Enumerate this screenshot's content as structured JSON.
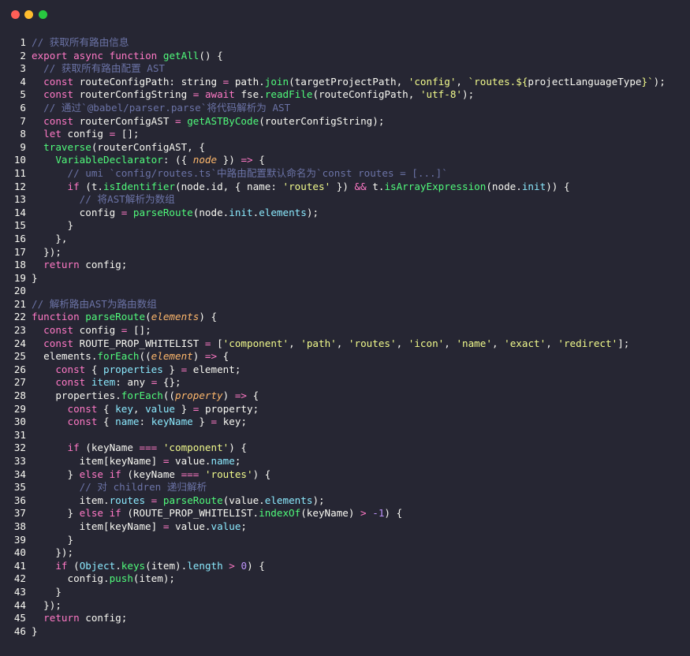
{
  "window": {
    "controls": [
      "close",
      "minimize",
      "zoom"
    ]
  },
  "colors": {
    "background": "#262633",
    "plain": "#f8f8f2",
    "keyword": "#ff79c6",
    "function": "#50fa7b",
    "string": "#f1fa8c",
    "comment": "#6b73a6",
    "param": "#ffb86c",
    "property": "#8be9fd",
    "number": "#bd93f9"
  },
  "lines": [
    [
      [
        "com",
        "// 获取所有路由信息"
      ]
    ],
    [
      [
        "kw",
        "export"
      ],
      [
        "plain",
        " "
      ],
      [
        "kw",
        "async"
      ],
      [
        "plain",
        " "
      ],
      [
        "kw",
        "function"
      ],
      [
        "plain",
        " "
      ],
      [
        "fn",
        "getAll"
      ],
      [
        "plain",
        "() {"
      ]
    ],
    [
      [
        "plain",
        "  "
      ],
      [
        "com",
        "// 获取所有路由配置 AST"
      ]
    ],
    [
      [
        "plain",
        "  "
      ],
      [
        "kw",
        "const"
      ],
      [
        "plain",
        " routeConfigPath: string "
      ],
      [
        "op",
        "="
      ],
      [
        "plain",
        " path."
      ],
      [
        "fn",
        "join"
      ],
      [
        "plain",
        "(targetProjectPath, "
      ],
      [
        "str",
        "'config'"
      ],
      [
        "plain",
        ", "
      ],
      [
        "str",
        "`routes.${"
      ],
      [
        "plain",
        "projectLanguageType"
      ],
      [
        "str",
        "}`"
      ],
      [
        "plain",
        ");"
      ]
    ],
    [
      [
        "plain",
        "  "
      ],
      [
        "kw",
        "const"
      ],
      [
        "plain",
        " routerConfigString "
      ],
      [
        "op",
        "="
      ],
      [
        "plain",
        " "
      ],
      [
        "kw",
        "await"
      ],
      [
        "plain",
        " fse."
      ],
      [
        "fn",
        "readFile"
      ],
      [
        "plain",
        "(routeConfigPath, "
      ],
      [
        "str",
        "'utf-8'"
      ],
      [
        "plain",
        ");"
      ]
    ],
    [
      [
        "plain",
        "  "
      ],
      [
        "com",
        "// 通过`@babel/parser.parse`将代码解析为 AST"
      ]
    ],
    [
      [
        "plain",
        "  "
      ],
      [
        "kw",
        "const"
      ],
      [
        "plain",
        " routerConfigAST "
      ],
      [
        "op",
        "="
      ],
      [
        "plain",
        " "
      ],
      [
        "fn",
        "getASTByCode"
      ],
      [
        "plain",
        "(routerConfigString);"
      ]
    ],
    [
      [
        "plain",
        "  "
      ],
      [
        "kw",
        "let"
      ],
      [
        "plain",
        " config "
      ],
      [
        "op",
        "="
      ],
      [
        "plain",
        " [];"
      ]
    ],
    [
      [
        "plain",
        "  "
      ],
      [
        "fn",
        "traverse"
      ],
      [
        "plain",
        "(routerConfigAST, {"
      ]
    ],
    [
      [
        "plain",
        "    "
      ],
      [
        "fn",
        "VariableDeclarator"
      ],
      [
        "plain",
        ": ({ "
      ],
      [
        "param",
        "node"
      ],
      [
        "plain",
        " }) "
      ],
      [
        "kw",
        "=>"
      ],
      [
        "plain",
        " {"
      ]
    ],
    [
      [
        "plain",
        "      "
      ],
      [
        "com",
        "// umi `config/routes.ts`中路由配置默认命名为`const routes = [...]`"
      ]
    ],
    [
      [
        "plain",
        "      "
      ],
      [
        "kw",
        "if"
      ],
      [
        "plain",
        " (t."
      ],
      [
        "fn",
        "isIdentifier"
      ],
      [
        "plain",
        "(node.id, { name: "
      ],
      [
        "str",
        "'routes'"
      ],
      [
        "plain",
        " }) "
      ],
      [
        "op",
        "&&"
      ],
      [
        "plain",
        " t."
      ],
      [
        "fn",
        "isArrayExpression"
      ],
      [
        "plain",
        "(node."
      ],
      [
        "prop",
        "init"
      ],
      [
        "plain",
        "))"
      ],
      [
        "plain",
        " {"
      ]
    ],
    [
      [
        "plain",
        "        "
      ],
      [
        "com",
        "// 将AST解析为数组"
      ]
    ],
    [
      [
        "plain",
        "        config "
      ],
      [
        "op",
        "="
      ],
      [
        "plain",
        " "
      ],
      [
        "fn",
        "parseRoute"
      ],
      [
        "plain",
        "(node."
      ],
      [
        "prop",
        "init"
      ],
      [
        "plain",
        "."
      ],
      [
        "prop",
        "elements"
      ],
      [
        "plain",
        ");"
      ]
    ],
    [
      [
        "plain",
        "      }"
      ]
    ],
    [
      [
        "plain",
        "    },"
      ]
    ],
    [
      [
        "plain",
        "  });"
      ]
    ],
    [
      [
        "plain",
        "  "
      ],
      [
        "kw",
        "return"
      ],
      [
        "plain",
        " config;"
      ]
    ],
    [
      [
        "plain",
        "}"
      ]
    ],
    [],
    [
      [
        "com",
        "// 解析路由AST为路由数组"
      ]
    ],
    [
      [
        "kw",
        "function"
      ],
      [
        "plain",
        " "
      ],
      [
        "fn",
        "parseRoute"
      ],
      [
        "plain",
        "("
      ],
      [
        "param",
        "elements"
      ],
      [
        "plain",
        ") {"
      ]
    ],
    [
      [
        "plain",
        "  "
      ],
      [
        "kw",
        "const"
      ],
      [
        "plain",
        " config "
      ],
      [
        "op",
        "="
      ],
      [
        "plain",
        " [];"
      ]
    ],
    [
      [
        "plain",
        "  "
      ],
      [
        "kw",
        "const"
      ],
      [
        "plain",
        " ROUTE_PROP_WHITELIST "
      ],
      [
        "op",
        "="
      ],
      [
        "plain",
        " ["
      ],
      [
        "str",
        "'component'"
      ],
      [
        "plain",
        ", "
      ],
      [
        "str",
        "'path'"
      ],
      [
        "plain",
        ", "
      ],
      [
        "str",
        "'routes'"
      ],
      [
        "plain",
        ", "
      ],
      [
        "str",
        "'icon'"
      ],
      [
        "plain",
        ", "
      ],
      [
        "str",
        "'name'"
      ],
      [
        "plain",
        ", "
      ],
      [
        "str",
        "'exact'"
      ],
      [
        "plain",
        ", "
      ],
      [
        "str",
        "'redirect'"
      ],
      [
        "plain",
        "];"
      ]
    ],
    [
      [
        "plain",
        "  elements."
      ],
      [
        "fn",
        "forEach"
      ],
      [
        "plain",
        "(("
      ],
      [
        "param",
        "element"
      ],
      [
        "plain",
        ") "
      ],
      [
        "kw",
        "=>"
      ],
      [
        "plain",
        " {"
      ]
    ],
    [
      [
        "plain",
        "    "
      ],
      [
        "kw",
        "const"
      ],
      [
        "plain",
        " { "
      ],
      [
        "prop",
        "properties"
      ],
      [
        "plain",
        " } "
      ],
      [
        "op",
        "="
      ],
      [
        "plain",
        " element;"
      ]
    ],
    [
      [
        "plain",
        "    "
      ],
      [
        "kw",
        "const"
      ],
      [
        "plain",
        " "
      ],
      [
        "prop",
        "item"
      ],
      [
        "plain",
        ": any "
      ],
      [
        "op",
        "="
      ],
      [
        "plain",
        " {};"
      ]
    ],
    [
      [
        "plain",
        "    properties."
      ],
      [
        "fn",
        "forEach"
      ],
      [
        "plain",
        "(("
      ],
      [
        "param",
        "property"
      ],
      [
        "plain",
        ") "
      ],
      [
        "kw",
        "=>"
      ],
      [
        "plain",
        " {"
      ]
    ],
    [
      [
        "plain",
        "      "
      ],
      [
        "kw",
        "const"
      ],
      [
        "plain",
        " { "
      ],
      [
        "prop",
        "key"
      ],
      [
        "plain",
        ", "
      ],
      [
        "prop",
        "value"
      ],
      [
        "plain",
        " } "
      ],
      [
        "op",
        "="
      ],
      [
        "plain",
        " property;"
      ]
    ],
    [
      [
        "plain",
        "      "
      ],
      [
        "kw",
        "const"
      ],
      [
        "plain",
        " { "
      ],
      [
        "prop",
        "name"
      ],
      [
        "plain",
        ": "
      ],
      [
        "prop",
        "keyName"
      ],
      [
        "plain",
        " } "
      ],
      [
        "op",
        "="
      ],
      [
        "plain",
        " key;"
      ]
    ],
    [],
    [
      [
        "plain",
        "      "
      ],
      [
        "kw",
        "if"
      ],
      [
        "plain",
        " (keyName "
      ],
      [
        "op",
        "==="
      ],
      [
        "plain",
        " "
      ],
      [
        "str",
        "'component'"
      ],
      [
        "plain",
        ") {"
      ]
    ],
    [
      [
        "plain",
        "        item[keyName] "
      ],
      [
        "op",
        "="
      ],
      [
        "plain",
        " value."
      ],
      [
        "prop",
        "name"
      ],
      [
        "plain",
        ";"
      ]
    ],
    [
      [
        "plain",
        "      } "
      ],
      [
        "kw",
        "else if"
      ],
      [
        "plain",
        " (keyName "
      ],
      [
        "op",
        "==="
      ],
      [
        "plain",
        " "
      ],
      [
        "str",
        "'routes'"
      ],
      [
        "plain",
        ") {"
      ]
    ],
    [
      [
        "plain",
        "        "
      ],
      [
        "com",
        "// 对 children 递归解析"
      ]
    ],
    [
      [
        "plain",
        "        item."
      ],
      [
        "prop",
        "routes"
      ],
      [
        "plain",
        " "
      ],
      [
        "op",
        "="
      ],
      [
        "plain",
        " "
      ],
      [
        "fn",
        "parseRoute"
      ],
      [
        "plain",
        "(value."
      ],
      [
        "prop",
        "elements"
      ],
      [
        "plain",
        ");"
      ]
    ],
    [
      [
        "plain",
        "      } "
      ],
      [
        "kw",
        "else if"
      ],
      [
        "plain",
        " (ROUTE_PROP_WHITELIST."
      ],
      [
        "fn",
        "indexOf"
      ],
      [
        "plain",
        "(keyName) "
      ],
      [
        "op",
        ">"
      ],
      [
        "plain",
        " "
      ],
      [
        "num",
        "-1"
      ],
      [
        "plain",
        ") {"
      ]
    ],
    [
      [
        "plain",
        "        item[keyName] "
      ],
      [
        "op",
        "="
      ],
      [
        "plain",
        " value."
      ],
      [
        "prop",
        "value"
      ],
      [
        "plain",
        ";"
      ]
    ],
    [
      [
        "plain",
        "      }"
      ]
    ],
    [
      [
        "plain",
        "    });"
      ]
    ],
    [
      [
        "plain",
        "    "
      ],
      [
        "kw",
        "if"
      ],
      [
        "plain",
        " ("
      ],
      [
        "prop",
        "Object"
      ],
      [
        "plain",
        "."
      ],
      [
        "fn",
        "keys"
      ],
      [
        "plain",
        "(item)."
      ],
      [
        "prop",
        "length"
      ],
      [
        "plain",
        " "
      ],
      [
        "op",
        ">"
      ],
      [
        "plain",
        " "
      ],
      [
        "num",
        "0"
      ],
      [
        "plain",
        ") {"
      ]
    ],
    [
      [
        "plain",
        "      config."
      ],
      [
        "fn",
        "push"
      ],
      [
        "plain",
        "(item);"
      ]
    ],
    [
      [
        "plain",
        "    }"
      ]
    ],
    [
      [
        "plain",
        "  });"
      ]
    ],
    [
      [
        "plain",
        "  "
      ],
      [
        "kw",
        "return"
      ],
      [
        "plain",
        " config;"
      ]
    ],
    [
      [
        "plain",
        "}"
      ]
    ]
  ]
}
